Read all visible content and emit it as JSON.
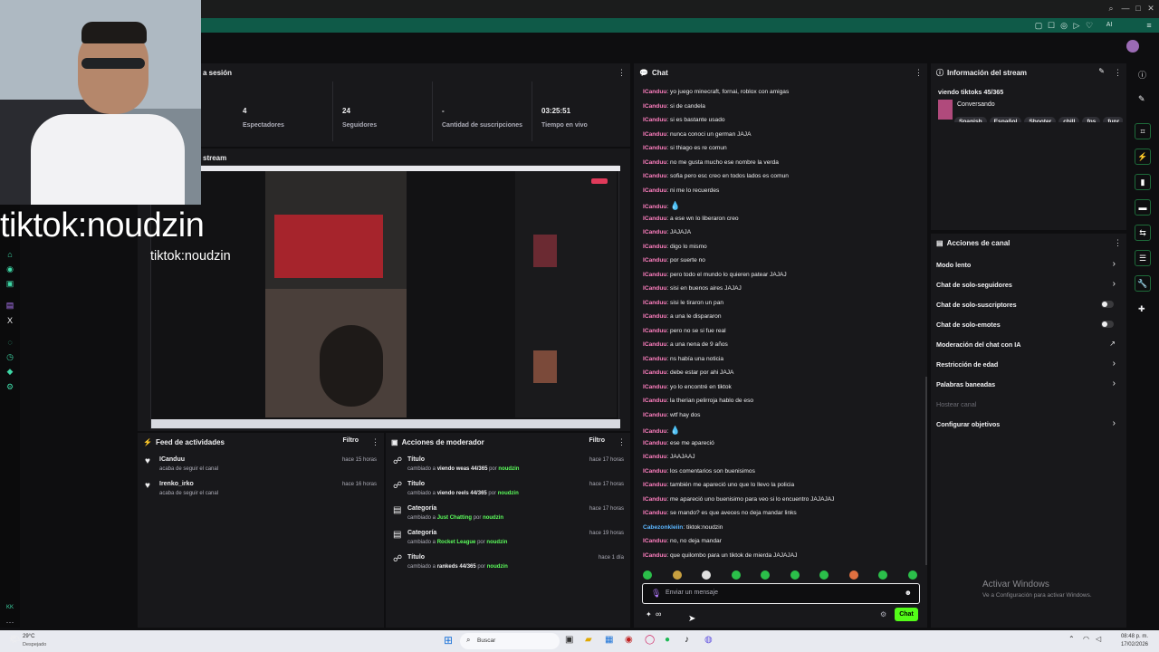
{
  "window": {
    "topbar_icons": [
      "search-icon",
      "minimize-icon",
      "maximize-icon",
      "close-icon"
    ],
    "ai_label": "AI"
  },
  "webcam": {
    "overlay_big": "tiktok:noudzin",
    "overlay_small": "tiktok:noudzin"
  },
  "session": {
    "title": "a sesión",
    "stats": [
      {
        "value": "4",
        "label": "Espectadores"
      },
      {
        "value": "24",
        "label": "Seguidores"
      },
      {
        "value": "-",
        "label": "Cantidad de suscripciones"
      },
      {
        "value": "03:25:51",
        "label": "Tiempo en vivo"
      }
    ]
  },
  "stream_preview": {
    "title": "stream"
  },
  "chat": {
    "title": "Chat",
    "messages": [
      {
        "user": "ICanduu",
        "text": "yo juego minecraft, fornai, roblox con amigas"
      },
      {
        "user": "ICanduu",
        "text": "si de candela"
      },
      {
        "user": "ICanduu",
        "text": "si es bastante usado"
      },
      {
        "user": "ICanduu",
        "text": "nunca conoci un german JAJA"
      },
      {
        "user": "ICanduu",
        "text": "si thiago es re comun"
      },
      {
        "user": "ICanduu",
        "text": "no me gusta mucho ese nombre la verda"
      },
      {
        "user": "ICanduu",
        "text": "sofia pero esc creo en todos lados es comun"
      },
      {
        "user": "ICanduu",
        "text": "ni me lo recuerdes"
      },
      {
        "user": "ICanduu",
        "text": "💧"
      },
      {
        "user": "ICanduu",
        "text": "a ese wn lo liberaron creo"
      },
      {
        "user": "ICanduu",
        "text": "JAJAJA"
      },
      {
        "user": "ICanduu",
        "text": "digo lo mismo"
      },
      {
        "user": "ICanduu",
        "text": "por suerte no"
      },
      {
        "user": "ICanduu",
        "text": "pero todo el mundo lo quieren patear JAJAJ"
      },
      {
        "user": "ICanduu",
        "text": "sisi en buenos aires JAJAJ"
      },
      {
        "user": "ICanduu",
        "text": "sisi le tiraron un pan"
      },
      {
        "user": "ICanduu",
        "text": "a una le dispararon"
      },
      {
        "user": "ICanduu",
        "text": "pero no se si fue real"
      },
      {
        "user": "ICanduu",
        "text": "a una nena de 9 años"
      },
      {
        "user": "ICanduu",
        "text": "ns había una noticia"
      },
      {
        "user": "ICanduu",
        "text": "debe estar por ahi JAJA"
      },
      {
        "user": "ICanduu",
        "text": "yo lo encontré en tiktok"
      },
      {
        "user": "ICanduu",
        "text": "la therian pelirroja hablo de eso"
      },
      {
        "user": "ICanduu",
        "text": "wtf hay dos"
      },
      {
        "user": "ICanduu",
        "text": "💧"
      },
      {
        "user": "ICanduu",
        "text": "ese me apareció"
      },
      {
        "user": "ICanduu",
        "text": "JAAJAAJ"
      },
      {
        "user": "ICanduu",
        "text": "los comentarios son buenisimos"
      },
      {
        "user": "ICanduu",
        "text": "también me apareció uno que lo llevo la policia"
      },
      {
        "user": "ICanduu",
        "text": "me apareció uno buenisimo para veo si lo encuentro JAJAJAJ"
      },
      {
        "user": "ICanduu",
        "text": "se mando? es que aveces no deja mandar links"
      },
      {
        "user": "Cabezonkleiin",
        "text": "tiktok:noudzin"
      },
      {
        "user": "ICanduu",
        "text": "no, no deja mandar"
      },
      {
        "user": "ICanduu",
        "text": "que quilombo para un tiktok de mierda JAJAJAJ"
      }
    ],
    "input_placeholder": "Enviar un mensaje",
    "send_label": "Chat",
    "points_label": "∞"
  },
  "stream_info": {
    "title": "Información del stream",
    "stream_title": "viendo tiktoks 45/365",
    "category": "Conversando",
    "tags": [
      "Spanish",
      "Español",
      "Shooter",
      "chill",
      "fps",
      "funr"
    ]
  },
  "channel_actions": {
    "title": "Acciones de canal",
    "items": [
      {
        "label": "Modo lento",
        "control": "arrow"
      },
      {
        "label": "Chat de solo-seguidores",
        "control": "arrow"
      },
      {
        "label": "Chat de solo-suscriptores",
        "control": "toggle"
      },
      {
        "label": "Chat de solo-emotes",
        "control": "toggle"
      },
      {
        "label": "Moderación del chat con IA",
        "control": "link"
      },
      {
        "label": "Restricción de edad",
        "control": "arrow"
      },
      {
        "label": "Palabras baneadas",
        "control": "arrow"
      },
      {
        "label": "Hostear canal",
        "control": "disabled"
      },
      {
        "label": "Configurar objetivos",
        "control": "arrow"
      }
    ]
  },
  "activity_feed": {
    "title": "Feed de actividades",
    "filter_label": "Filtro",
    "items": [
      {
        "name": "ICanduu",
        "sub": "acaba de seguir el canal",
        "time": "hace 15 horas"
      },
      {
        "name": "Irenko_irko",
        "sub": "acaba de seguir el canal",
        "time": "hace 16 horas"
      }
    ]
  },
  "mod_actions": {
    "title": "Acciones de moderador",
    "filter_label": "Filtro",
    "items": [
      {
        "kind": "Título",
        "prefix": "cambiado a",
        "value": "viendo weas 44/365",
        "by": "por",
        "user": "noudzin",
        "time": "hace 17 horas",
        "green_value": false
      },
      {
        "kind": "Título",
        "prefix": "cambiado a",
        "value": "viendo reels 44/365",
        "by": "por",
        "user": "noudzin",
        "time": "hace 17 horas",
        "green_value": false
      },
      {
        "kind": "Categoría",
        "prefix": "cambiado a",
        "value": "Just Chatting",
        "by": "por",
        "user": "noudzin",
        "time": "hace 17 horas",
        "green_value": true
      },
      {
        "kind": "Categoría",
        "prefix": "cambiado a",
        "value": "Rocket League",
        "by": "por",
        "user": "noudzin",
        "time": "hace 19 horas",
        "green_value": true
      },
      {
        "kind": "Título",
        "prefix": "cambiado a",
        "value": "rankeds 44/365",
        "by": "por",
        "user": "noudzin",
        "time": "hace 1 día",
        "green_value": false
      }
    ]
  },
  "windows_watermark": {
    "line1": "Activar Windows",
    "line2": "Ve a Configuración para activar Windows."
  },
  "taskbar": {
    "weather_temp": "29°C",
    "weather_desc": "Despejado",
    "search_placeholder": "Buscar",
    "time": "08:48 p. m.",
    "date": "17/02/2026"
  },
  "colors": {
    "accent": "#53fc18",
    "pink_user": "#ff7fc0",
    "blue_user": "#5bb6ff",
    "teal": "#0f5a48"
  }
}
